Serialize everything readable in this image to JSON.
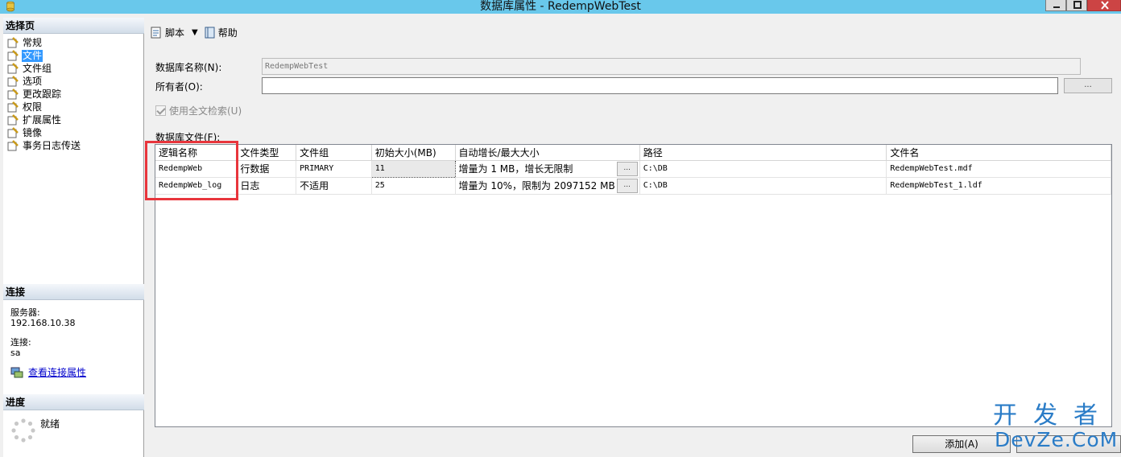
{
  "window": {
    "title": "数据库属性 - RedempWebTest"
  },
  "sidebar": {
    "select_page_header": "选择页",
    "items": [
      {
        "label": "常规",
        "selected": false
      },
      {
        "label": "文件",
        "selected": true
      },
      {
        "label": "文件组",
        "selected": false
      },
      {
        "label": "选项",
        "selected": false
      },
      {
        "label": "更改跟踪",
        "selected": false
      },
      {
        "label": "权限",
        "selected": false
      },
      {
        "label": "扩展属性",
        "selected": false
      },
      {
        "label": "镜像",
        "selected": false
      },
      {
        "label": "事务日志传送",
        "selected": false
      }
    ],
    "connection_header": "连接",
    "server_label": "服务器:",
    "server_value": "192.168.10.38",
    "connection_label": "连接:",
    "connection_value": "sa",
    "view_connection_link": "查看连接属性",
    "progress_header": "进度",
    "progress_status": "就绪"
  },
  "toolbar": {
    "script_label": "脚本",
    "help_label": "帮助"
  },
  "form": {
    "db_name_label": "数据库名称(N):",
    "db_name_value": "RedempWebTest",
    "owner_label": "所有者(O):",
    "owner_value": "",
    "owner_browse": "...",
    "fulltext_label": "使用全文检索(U)",
    "fulltext_checked": true,
    "db_files_label": "数据库文件(F):"
  },
  "grid": {
    "columns": [
      "逻辑名称",
      "文件类型",
      "文件组",
      "初始大小(MB)",
      "自动增长/最大大小",
      "路径",
      "文件名"
    ],
    "rows": [
      {
        "logical": "RedempWeb",
        "type": "行数据",
        "filegroup": "PRIMARY",
        "size": "11",
        "growth": "增量为 1 MB，增长无限制",
        "growth_btn": "...",
        "path": "C:\\DB",
        "filename": "RedempWebTest.mdf"
      },
      {
        "logical": "RedempWeb_log",
        "type": "日志",
        "filegroup": "不适用",
        "size": "25",
        "growth": "增量为 10%，限制为 2097152 MB",
        "growth_btn": "...",
        "path": "C:\\DB",
        "filename": "RedempWebTest_1.ldf"
      }
    ]
  },
  "buttons": {
    "add_label": "添加(A)"
  },
  "watermark": {
    "line1": "开发者",
    "line2": "DevZe.CoM"
  },
  "colors": {
    "titlebar": "#69c8eb",
    "selection": "#3399ff",
    "highlight": "#e8353c",
    "watermark": "#2a7cc7"
  }
}
